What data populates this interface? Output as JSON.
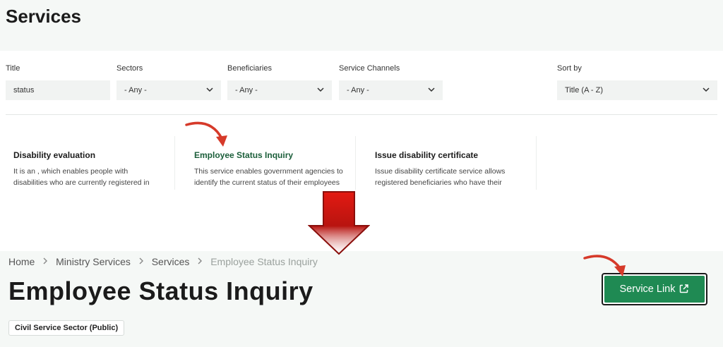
{
  "services_page": {
    "title": "Services",
    "filters": [
      {
        "label": "Title",
        "value": "status"
      },
      {
        "label": "Sectors",
        "value": "- Any -"
      },
      {
        "label": "Beneficiaries",
        "value": "- Any -"
      },
      {
        "label": "Service Channels",
        "value": "- Any -"
      },
      {
        "label": "Sort by",
        "value": "Title (A - Z)"
      }
    ],
    "cards": [
      {
        "title": "Disability evaluation",
        "desc1": "It is an , which enables people with",
        "desc2": "disabilities who are currently registered in"
      },
      {
        "title": "Employee Status Inquiry",
        "desc1": "This service enables government agencies to",
        "desc2": "identify the current status of their employees"
      },
      {
        "title": "Issue disability certificate",
        "desc1": "Issue disability certificate service allows",
        "desc2": "registered beneficiaries who have their"
      }
    ]
  },
  "detail_page": {
    "breadcrumb": [
      "Home",
      "Ministry Services",
      "Services",
      "Employee Status Inquiry"
    ],
    "title": "Employee Status Inquiry",
    "tag": "Civil Service Sector (Public)",
    "service_link_label": "Service Link"
  },
  "colors": {
    "accent_green": "#1f8a53",
    "annotation_red": "#d63a2a"
  },
  "icons": [
    "chevron-down-icon",
    "chevron-right-icon",
    "external-link-icon",
    "curved-arrow-icon",
    "down-arrow-icon"
  ]
}
